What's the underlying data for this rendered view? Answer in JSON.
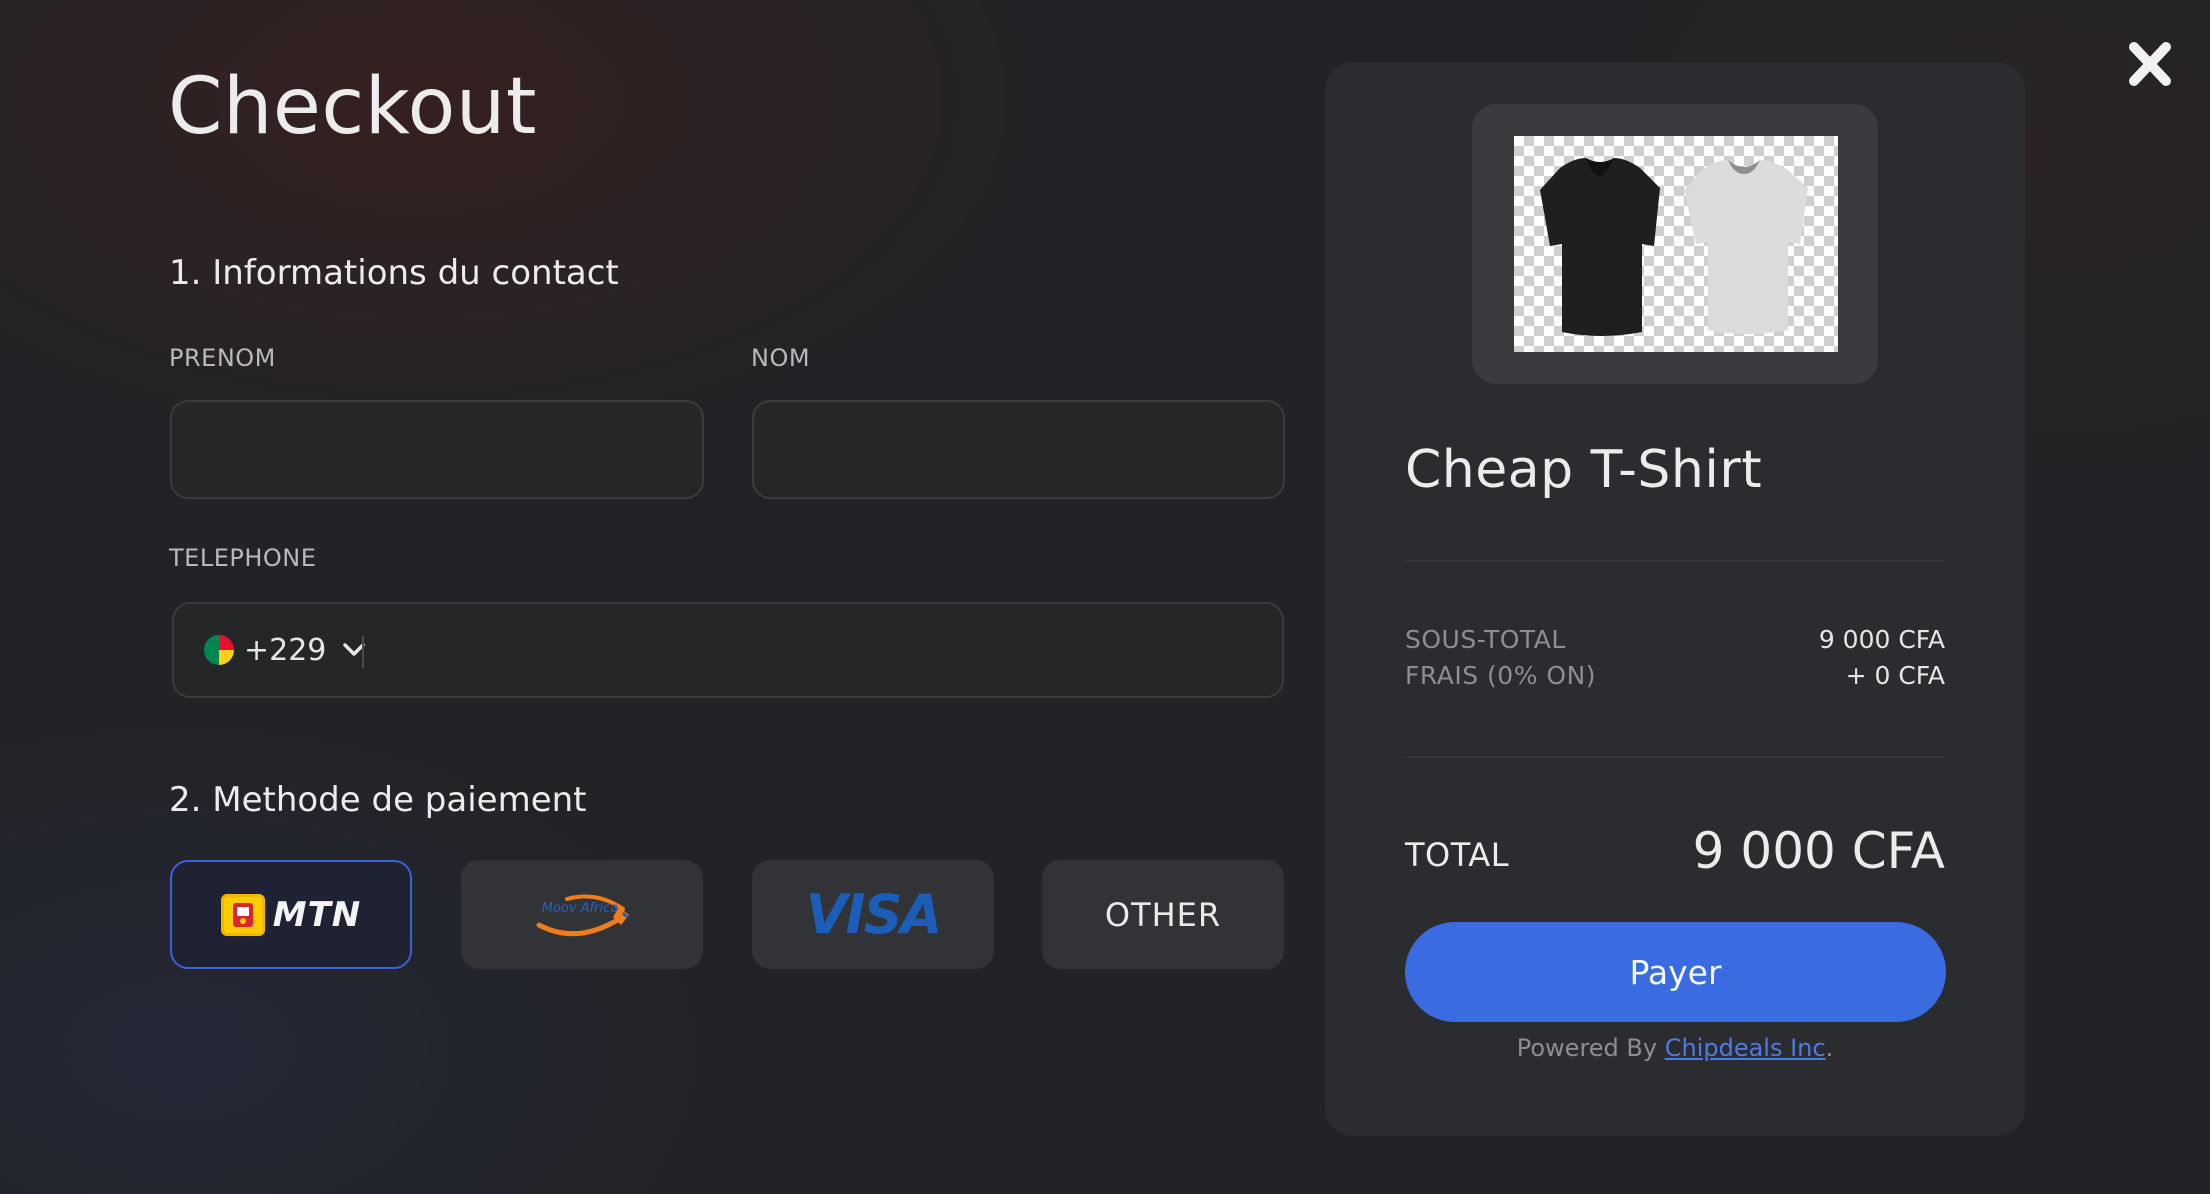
{
  "page": {
    "title": "Checkout",
    "close_icon": "close-icon"
  },
  "contact": {
    "section_title": "1. Informations du contact",
    "first_name": {
      "label": "PRENOM",
      "value": "",
      "placeholder": ""
    },
    "last_name": {
      "label": "NOM",
      "value": "",
      "placeholder": ""
    },
    "phone": {
      "label": "TELEPHONE",
      "country_flag_icon": "benin-flag-icon",
      "dial_code": "+229",
      "value": "",
      "placeholder": ""
    }
  },
  "payment": {
    "section_title": "2. Methode de paiement",
    "options": [
      {
        "id": "mtn",
        "logo_text": "MTN",
        "selected": true
      },
      {
        "id": "moov",
        "logo_text": "Moov Africa",
        "selected": false
      },
      {
        "id": "visa",
        "logo_text": "VISA",
        "selected": false
      },
      {
        "id": "other",
        "label": "OTHER",
        "selected": false
      }
    ]
  },
  "summary": {
    "product_name": "Cheap T-Shirt",
    "product_image_icon": "tshirt-product-image",
    "subtotal_label": "SOUS-TOTAL",
    "subtotal_value": "9 000 CFA",
    "fees_label": "FRAIS (0% ON)",
    "fees_value": "+ 0 CFA",
    "total_label": "TOTAL",
    "total_value": "9 000 CFA",
    "pay_button_label": "Payer",
    "powered_by_prefix": "Powered By ",
    "powered_by_link": "Chipdeals Inc",
    "powered_by_suffix": "."
  },
  "colors": {
    "background": "#222326",
    "card": "#2b2c2f",
    "accent": "#3a6be0",
    "selected_border": "#3b63d9"
  }
}
